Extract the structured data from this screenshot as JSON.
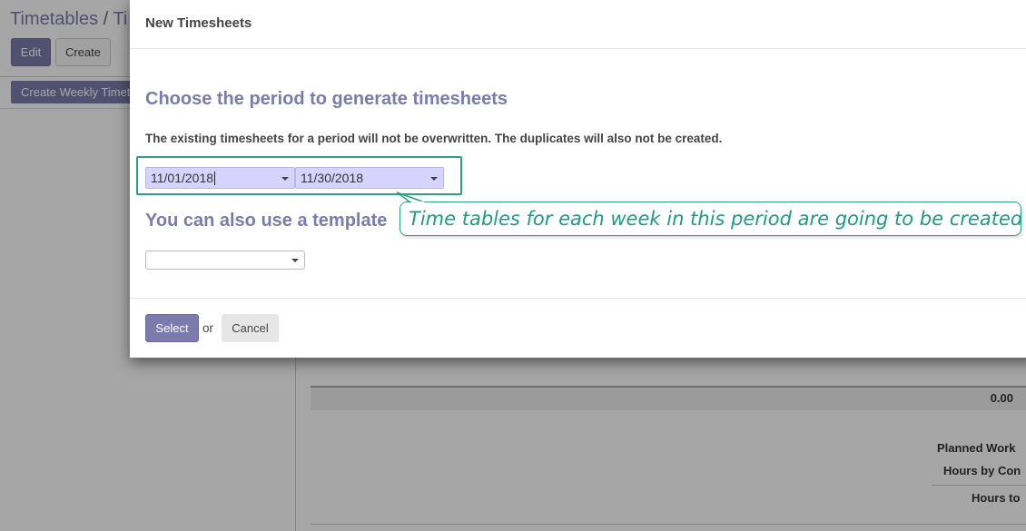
{
  "background": {
    "breadcrumb": {
      "root": "Timetables",
      "separator": "/",
      "current": "Ti"
    },
    "edit_label": "Edit",
    "create_label": "Create",
    "weekly_button_label": "Create Weekly Timetable",
    "total_value": "0.00",
    "summary_labels": {
      "planned_work": "Planned Work",
      "hours_by_contract": "Hours by Con",
      "hours_to": "Hours to"
    }
  },
  "modal": {
    "title": "New Timesheets",
    "period_heading": "Choose the period to generate timesheets",
    "notice": "The existing timesheets for a period will not be overwritten. The duplicates will also not be created.",
    "start_date": "11/01/2018",
    "end_date": "11/30/2018",
    "template_heading": "You can also use a template",
    "template_value": "",
    "select_label": "Select",
    "or_label": "or",
    "cancel_label": "Cancel"
  },
  "callout": {
    "text": "Time tables for each week in this period are going to be created"
  },
  "colors": {
    "accent": "#7c7bad",
    "callout": "#1f9b82",
    "date_field_bg": "#d6d4ff"
  }
}
